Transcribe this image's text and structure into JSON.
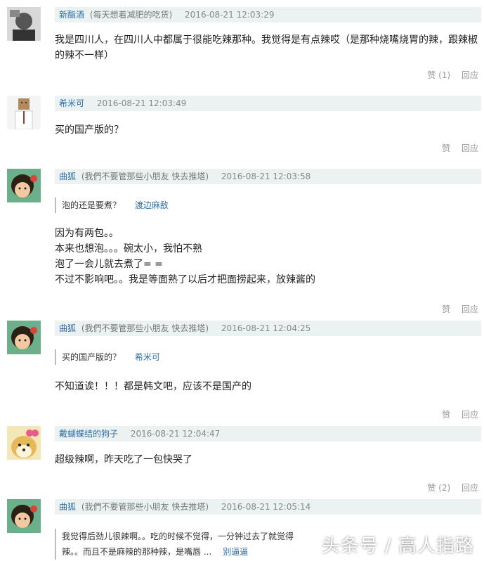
{
  "comments": [
    {
      "user": "新酯酒",
      "note": "(每天想着减肥的吃货)",
      "time": "2016-08-21 12:03:29",
      "lines": [
        "我是四川人，在四川人中都属于很能吃辣那种。我觉得是有点辣哎（是那种烧嘴烧胃的辣，跟辣椒",
        "的辣不一样）"
      ],
      "like": "赞 (1)",
      "reply": "回应"
    },
    {
      "user": "希米可",
      "note": "",
      "time": "2016-08-21 12:03:49",
      "lines": [
        "买的国产版的？"
      ],
      "like": "赞",
      "reply": "回应"
    },
    {
      "user": "曲狐",
      "note": "(我們不要管那些小朋友 快去推塔)",
      "time": "2016-08-21 12:03:58",
      "quote": "泡的还是要煮？",
      "quote_user": "渡边麻敌",
      "lines": [
        "因为有两包。。",
        "本来也想泡。。。碗太小，我怕不熟",
        "泡了一会儿就去煮了= =",
        "不过不影响吧。。我是等面熟了以后才把面捞起来，放辣酱的"
      ],
      "like": "赞",
      "reply": "回应"
    },
    {
      "user": "曲狐",
      "note": "(我們不要管那些小朋友 快去推塔)",
      "time": "2016-08-21 12:04:25",
      "quote": "买的国产版的？",
      "quote_user": "希米可",
      "lines": [
        "不知道诶！！！都是韩文吧，应该不是国产的"
      ],
      "like": "赞",
      "reply": "回应"
    },
    {
      "user": "戴蝴蝶结的狗子",
      "note": "",
      "time": "2016-08-21 12:04:47",
      "lines": [
        "超级辣啊，昨天吃了一包快哭了"
      ],
      "like": "赞 (2)",
      "reply": "回应"
    },
    {
      "user": "曲狐",
      "note": "(我們不要管那些小朋友 快去推塔)",
      "time": "2016-08-21 12:05:14",
      "quote_lines": [
        "我觉得后劲儿很辣啊。。吃的时候不觉得，一分钟过去了就觉得",
        "辣。。而且不是麻辣的那种辣，是嘴唇 ..."
      ],
      "quote_user": "别逼逼"
    }
  ],
  "watermark": "头条号 / 高人指路"
}
